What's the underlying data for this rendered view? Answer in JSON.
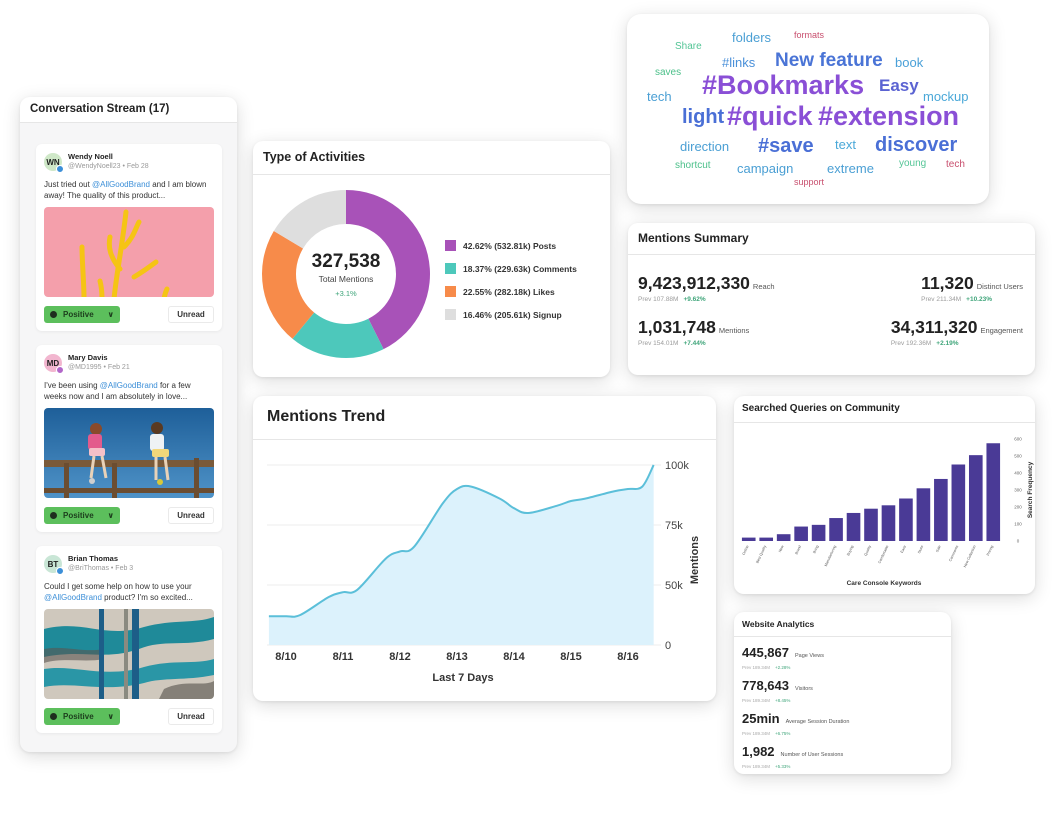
{
  "conversation_stream": {
    "title": "Conversation Stream (17)",
    "posts": [
      {
        "initials": "WN",
        "avatar_color": "#cfe8c8",
        "badge_color": "#3c8fd8",
        "name": "Wendy Noell",
        "handle": "@WendyNoell23",
        "date": "Feb 28",
        "text_before": "Just tried out ",
        "mention": "@AllGoodBrand",
        "text_after": " and I am blown away! The quality of this product...",
        "image": "pink-background-yellow-coral",
        "sentiment": "Positive",
        "status": "Unread"
      },
      {
        "initials": "MD",
        "avatar_color": "#f2b6cf",
        "badge_color": "#b267c9",
        "name": "Mary Davis",
        "handle": "@MD1995",
        "date": "Feb 21",
        "text_before": "I've been using ",
        "mention": "@AllGoodBrand",
        "text_after": " for a few weeks now and I am absolutely in love...",
        "image": "two-people-on-fence-blue-sky",
        "sentiment": "Positive",
        "status": "Unread"
      },
      {
        "initials": "BT",
        "avatar_color": "#c9e6d6",
        "badge_color": "#3c8fd8",
        "name": "Brian Thomas",
        "handle": "@BriThomas",
        "date": "Feb 3",
        "text_before": "Could I get some help on how to use your ",
        "mention": "@AllGoodBrand",
        "text_after": " product? I'm so excited...",
        "image": "aerial-teal-river",
        "sentiment": "Positive",
        "status": "Unread"
      }
    ]
  },
  "word_cloud": {
    "words": [
      {
        "text": "folders",
        "color": "#4a9fd4"
      },
      {
        "text": "formats",
        "color": "#c84f6e"
      },
      {
        "text": "Share",
        "color": "#54c596"
      },
      {
        "text": "#links",
        "color": "#4a90d9"
      },
      {
        "text": "New feature",
        "color": "#4a74d6"
      },
      {
        "text": "book",
        "color": "#4aa0d8"
      },
      {
        "text": "saves",
        "color": "#4cc08a"
      },
      {
        "text": "#Bookmarks",
        "color": "#8a4fd6"
      },
      {
        "text": "Easy",
        "color": "#5b63d2"
      },
      {
        "text": "tech",
        "color": "#4a9fd4"
      },
      {
        "text": "mockup",
        "color": "#4aa8d8"
      },
      {
        "text": "light",
        "color": "#4a6fd6"
      },
      {
        "text": "#quick",
        "color": "#8a4fd6"
      },
      {
        "text": "#extension",
        "color": "#8a4fd6"
      },
      {
        "text": "direction",
        "color": "#4a9fd4"
      },
      {
        "text": "#save",
        "color": "#4a6fd6"
      },
      {
        "text": "text",
        "color": "#4aa8d8"
      },
      {
        "text": "discover",
        "color": "#4a6fd6"
      },
      {
        "text": "shortcut",
        "color": "#4cc08a"
      },
      {
        "text": "campaign",
        "color": "#4a9fd4"
      },
      {
        "text": "extreme",
        "color": "#4a9fd4"
      },
      {
        "text": "young",
        "color": "#54c596"
      },
      {
        "text": "tech",
        "color": "#c84f6e"
      },
      {
        "text": "support",
        "color": "#c84f6e"
      }
    ]
  },
  "activities": {
    "title": "Type of Activities",
    "total": "327,538",
    "total_label": "Total Mentions",
    "change": "+3.1%",
    "legend": [
      {
        "label": "42.62% (532.81k) Posts",
        "color": "#a852b8"
      },
      {
        "label": "18.37% (229.63k) Comments",
        "color": "#4dc8bb"
      },
      {
        "label": "22.55% (282.18k) Likes",
        "color": "#f78b4a"
      },
      {
        "label": "16.46% (205.61k) Signup",
        "color": "#dedede"
      }
    ]
  },
  "mentions_summary": {
    "title": "Mentions Summary",
    "metrics": [
      {
        "value": "9,423,912,330",
        "label": "Reach",
        "prev": "Prev 107.88M",
        "change": "+9.62%"
      },
      {
        "value": "11,320",
        "label": "Distinct Users",
        "prev": "Prev 211.34M",
        "change": "+10.23%"
      },
      {
        "value": "1,031,748",
        "label": "Mentions",
        "prev": "Prev 154.01M",
        "change": "+7.44%"
      },
      {
        "value": "34,311,320",
        "label": "Engagement",
        "prev": "Prev 192.36M",
        "change": "+2.19%"
      }
    ]
  },
  "website_analytics": {
    "title": "Website Analytics",
    "metrics": [
      {
        "value": "445,867",
        "label": "Page Views",
        "prev": "Prev 189.34M",
        "change": "+2.28%"
      },
      {
        "value": "778,643",
        "label": "Visitors",
        "prev": "Prev 189.34M",
        "change": "+8.45%"
      },
      {
        "value": "25min",
        "label": "Average Session Duration",
        "prev": "Prev 189.34M",
        "change": "+6.75%"
      },
      {
        "value": "1,982",
        "label": "Number of User Sessions",
        "prev": "Prev 189.34M",
        "change": "+5.33%"
      }
    ]
  },
  "chart_data": [
    {
      "id": "type-of-activities",
      "type": "pie",
      "title": "Type of Activities",
      "categories": [
        "Posts",
        "Comments",
        "Likes",
        "Signup"
      ],
      "values": [
        42.62,
        18.37,
        22.55,
        16.46
      ],
      "counts": [
        "532.81k",
        "229.63k",
        "282.18k",
        "205.61k"
      ],
      "colors": [
        "#a852b8",
        "#4dc8bb",
        "#f78b4a",
        "#dedede"
      ],
      "center_value": "327,538",
      "center_label": "Total Mentions",
      "legend": "right"
    },
    {
      "id": "mentions-trend",
      "type": "area",
      "title": "Mentions Trend",
      "xlabel": "Last 7 Days",
      "ylabel": "Mentions",
      "x": [
        "8/10",
        "8/11",
        "8/12",
        "8/13",
        "8/14",
        "8/15",
        "8/16"
      ],
      "points": [
        {
          "x": -0.3,
          "y": 37000
        },
        {
          "x": 0,
          "y": 37000
        },
        {
          "x": 0.25,
          "y": 37500
        },
        {
          "x": 0.75,
          "y": 45000
        },
        {
          "x": 1,
          "y": 47000
        },
        {
          "x": 1.25,
          "y": 48000
        },
        {
          "x": 1.75,
          "y": 61000
        },
        {
          "x": 2,
          "y": 64000
        },
        {
          "x": 2.25,
          "y": 66000
        },
        {
          "x": 2.75,
          "y": 84000
        },
        {
          "x": 3,
          "y": 90000
        },
        {
          "x": 3.25,
          "y": 91000
        },
        {
          "x": 3.75,
          "y": 86000
        },
        {
          "x": 4,
          "y": 82000
        },
        {
          "x": 4.25,
          "y": 80000
        },
        {
          "x": 4.75,
          "y": 83000
        },
        {
          "x": 5,
          "y": 85000
        },
        {
          "x": 5.25,
          "y": 86000
        },
        {
          "x": 5.75,
          "y": 89000
        },
        {
          "x": 6,
          "y": 90000
        },
        {
          "x": 6.25,
          "y": 91000
        },
        {
          "x": 6.45,
          "y": 100000
        }
      ],
      "y_ticks": [
        {
          "value": 25000,
          "label": "0"
        },
        {
          "value": 50000,
          "label": "50k"
        },
        {
          "value": 75000,
          "label": "75k"
        },
        {
          "value": 100000,
          "label": "100k"
        }
      ],
      "ylim": [
        25000,
        100000
      ],
      "line_color": "#5bbfd9",
      "fill_color": "#dcf2fc",
      "grid": true
    },
    {
      "id": "searched-queries",
      "type": "bar",
      "title": "Searched Queries on Community",
      "xlabel": "Care Console Keywords",
      "ylabel": "Search Frequency",
      "categories": [
        "Online",
        "Best Quality",
        "New",
        "Brand",
        "Bring",
        "Manufacturing",
        "Buying",
        "Quality",
        "Comfortable",
        "Easy",
        "Store",
        "Sale",
        "Comments",
        "New Collection",
        "Pricing"
      ],
      "values": [
        20,
        20,
        40,
        85,
        95,
        135,
        165,
        190,
        210,
        250,
        310,
        365,
        450,
        505,
        575
      ],
      "y_ticks": [
        0,
        100,
        200,
        300,
        400,
        500,
        600
      ],
      "ylim": [
        0,
        600
      ],
      "bar_color": "#4a3a96",
      "grid": false
    }
  ]
}
